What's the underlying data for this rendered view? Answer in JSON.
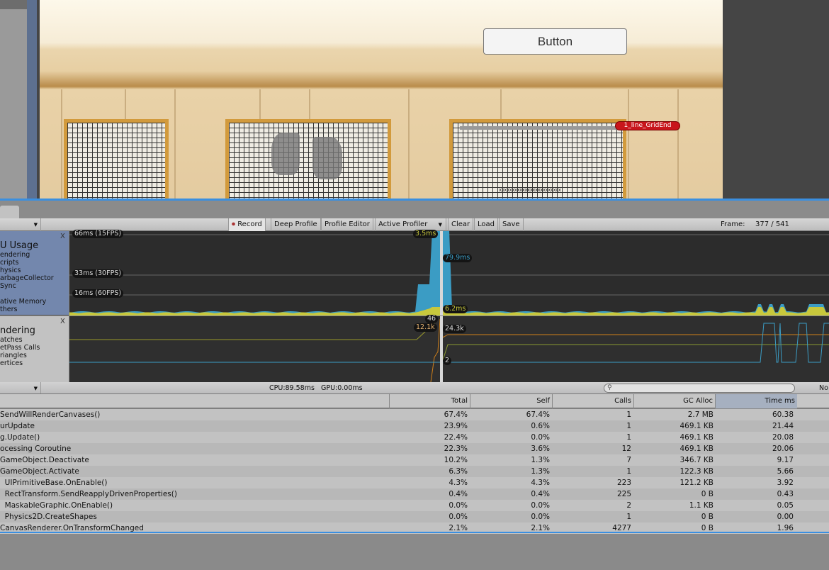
{
  "game": {
    "button_label": "Button",
    "tag_label": "1_line_GridEnd",
    "cross_marks": "xxxxxxxxxxxxxxxxxxxxxxxx"
  },
  "toolbar": {
    "record": "Record",
    "deep_profile": "Deep Profile",
    "profile_editor": "Profile Editor",
    "active_profiler": "Active Profiler",
    "clear": "Clear",
    "load": "Load",
    "save": "Save",
    "frame_label": "Frame:",
    "frame_value": "377 / 541"
  },
  "cpu_panel": {
    "title": "U Usage",
    "items": [
      "endering",
      "cripts",
      "hysics",
      "arbageCollector",
      "Sync",
      "",
      "ative Memory",
      "thers"
    ],
    "gridlines": [
      "66ms (15FPS)",
      "33ms (30FPS)",
      "16ms (60FPS)"
    ],
    "markers": [
      "3.5ms",
      "79.9ms",
      "6.2ms"
    ]
  },
  "render_panel": {
    "title": "ndering",
    "items": [
      "atches",
      "etPass Calls",
      "riangles",
      "ertices"
    ],
    "markers": [
      "46",
      "12.1k",
      "24.3k",
      "2"
    ]
  },
  "status": {
    "cpu_gpu": "CPU:89.58ms   GPU:0.00ms",
    "search_placeholder": "",
    "right_cut": "No"
  },
  "colors": {
    "scripts": "#3b9cc4",
    "rendering": "#c8c83c",
    "selection": "#d8d8d8",
    "accent": "#3a8fe0",
    "tag": "#c8151b"
  },
  "table": {
    "columns": [
      "Total",
      "Self",
      "Calls",
      "GC Alloc",
      "Time ms"
    ],
    "rows": [
      [
        "SendWillRenderCanvases()",
        "67.4%",
        "67.4%",
        "1",
        "2.7 MB",
        "60.38"
      ],
      [
        "urUpdate",
        "23.9%",
        "0.6%",
        "1",
        "469.1 KB",
        "21.44"
      ],
      [
        "g.Update()",
        "22.4%",
        "0.0%",
        "1",
        "469.1 KB",
        "20.08"
      ],
      [
        "ocessing Coroutine",
        "22.3%",
        "3.6%",
        "12",
        "469.1 KB",
        "20.06"
      ],
      [
        "GameObject.Deactivate",
        "10.2%",
        "1.3%",
        "7",
        "346.7 KB",
        "9.17"
      ],
      [
        "GameObject.Activate",
        "6.3%",
        "1.3%",
        "1",
        "122.3 KB",
        "5.66"
      ],
      [
        "  UIPrimitiveBase.OnEnable()",
        "4.3%",
        "4.3%",
        "223",
        "121.2 KB",
        "3.92"
      ],
      [
        "  RectTransform.SendReapplyDrivenProperties()",
        "0.4%",
        "0.4%",
        "225",
        "0 B",
        "0.43"
      ],
      [
        "  MaskableGraphic.OnEnable()",
        "0.0%",
        "0.0%",
        "2",
        "1.1 KB",
        "0.05"
      ],
      [
        "  Physics2D.CreateShapes",
        "0.0%",
        "0.0%",
        "1",
        "0 B",
        "0.00"
      ],
      [
        "CanvasRenderer.OnTransformChanged",
        "2.1%",
        "2.1%",
        "4277",
        "0 B",
        "1.96"
      ]
    ]
  }
}
